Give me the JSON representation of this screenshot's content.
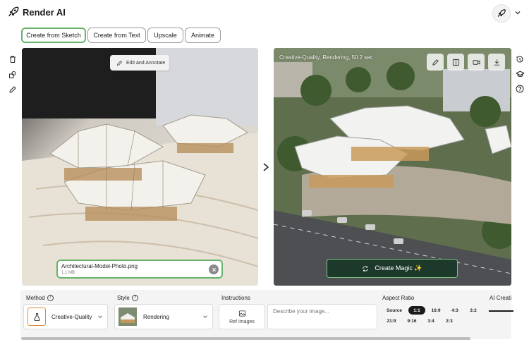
{
  "header": {
    "title": "Render AI",
    "logo_icon": "rocket-icon",
    "avatar_icon": "rocket-icon"
  },
  "tabs": [
    {
      "label": "Create from Sketch",
      "active": true
    },
    {
      "label": "Create from Text",
      "active": false
    },
    {
      "label": "Upscale",
      "active": false
    },
    {
      "label": "Animate",
      "active": false
    }
  ],
  "left_toolbar": [
    "trash-icon",
    "shapes-icon",
    "pencil-icon"
  ],
  "right_toolbar": [
    "history-icon",
    "graduation-cap-icon",
    "help-icon"
  ],
  "source_panel": {
    "edit_button": "Edit and Annotate",
    "file_name": "Architectural-Model-Photo.png",
    "file_size": "1.1 MB"
  },
  "result_panel": {
    "caption": "Creative-Quality, Rendering, 50.2 sec",
    "tools": [
      "pencil-icon",
      "compare-icon",
      "video-icon",
      "download-icon"
    ],
    "create_button": "Create Magic ✨"
  },
  "controls": {
    "method_label": "Method",
    "method_value": "Creative-Quality",
    "style_label": "Style",
    "style_value": "Rendering",
    "instructions_label": "Instructions",
    "ref_images_label": "Ref Images",
    "instructions_placeholder": "Describe your image...",
    "aspect_label": "Aspect Ratio",
    "aspect_row1": [
      "Source",
      "1:1",
      "16:9",
      "4:3",
      "3:2"
    ],
    "aspect_row2": [
      "21:9",
      "9:16",
      "3:4",
      "2:3"
    ],
    "aspect_selected": "1:1",
    "creativity_label": "AI Creati"
  },
  "colors": {
    "accent_green": "#67b36b",
    "dark_button": "#193728"
  }
}
